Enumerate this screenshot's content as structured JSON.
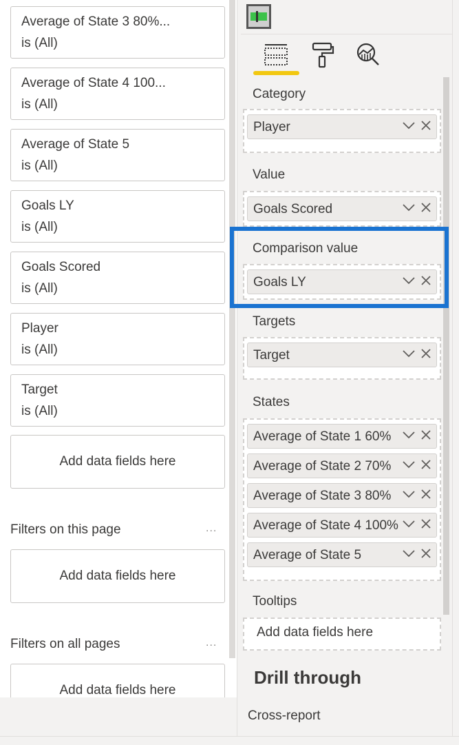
{
  "filters_pane": {
    "visual_filters": [
      {
        "field": "Average of State 3 80%...",
        "state": "is (All)"
      },
      {
        "field": "Average of State 4 100...",
        "state": "is (All)"
      },
      {
        "field": "Average of State 5",
        "state": "is (All)"
      },
      {
        "field": "Goals LY",
        "state": "is (All)"
      },
      {
        "field": "Goals Scored",
        "state": "is (All)"
      },
      {
        "field": "Player",
        "state": "is (All)"
      },
      {
        "field": "Target",
        "state": "is (All)"
      }
    ],
    "visual_add_placeholder": "Add data fields here",
    "page_section": {
      "title": "Filters on this page",
      "more": "...",
      "placeholder": "Add data fields here"
    },
    "all_pages_section": {
      "title": "Filters on all pages",
      "more": "...",
      "placeholder": "Add data fields here"
    }
  },
  "viz_pane": {
    "visual_icon": "bullet-chart-visual-icon",
    "tabs": [
      {
        "name": "fields",
        "icon": "fields-icon",
        "active": true
      },
      {
        "name": "format",
        "icon": "paint-roller-icon",
        "active": false
      },
      {
        "name": "analytics",
        "icon": "analytics-magnifier-icon",
        "active": false
      }
    ],
    "wells": {
      "category": {
        "label": "Category",
        "fields": [
          "Player"
        ]
      },
      "value": {
        "label": "Value",
        "fields": [
          "Goals Scored"
        ]
      },
      "comparison": {
        "label": "Comparison value",
        "fields": [
          "Goals LY"
        ]
      },
      "targets": {
        "label": "Targets",
        "fields": [
          "Target"
        ]
      },
      "states": {
        "label": "States",
        "fields": [
          "Average of State 1 60%",
          "Average of State 2 70%",
          "Average of State 3 80%",
          "Average of State 4 100%",
          "Average of State 5"
        ]
      },
      "tooltips": {
        "label": "Tooltips",
        "placeholder": "Add data fields here"
      }
    },
    "drill_through": {
      "title": "Drill through",
      "cross_report": "Cross-report"
    }
  },
  "colors": {
    "highlight": "#1a73d1",
    "active_tab_underline": "#f2c811",
    "visual_icon_green": "#3cc24a"
  }
}
